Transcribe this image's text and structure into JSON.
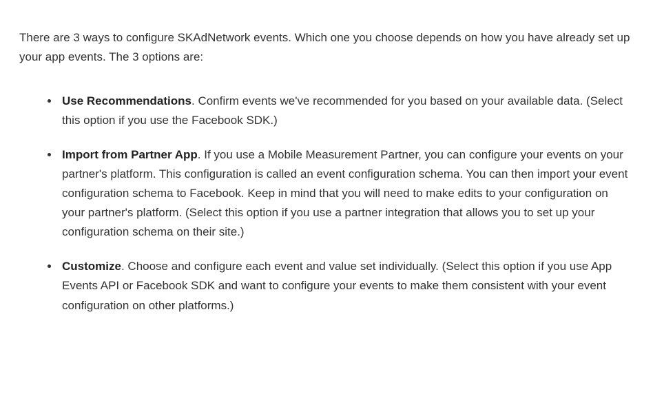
{
  "intro": "There are 3 ways to configure SKAdNetwork events. Which one you choose depends on how you have already set up your app events. The 3 options are:",
  "options": [
    {
      "title": "Use Recommendations",
      "desc": ". Confirm events we've recommended for you based on your available data. (Select this option if you use the Facebook SDK.)"
    },
    {
      "title": "Import from Partner App",
      "desc": ". If you use a Mobile Measurement Partner, you can configure your events on your partner's platform. This configuration is called an event configuration schema. You can then import your event configuration schema to Facebook. Keep in mind that you will need to make edits to your configuration on your partner's platform. (Select this option if you use a partner integration that allows you to set up your configuration schema on their site.)"
    },
    {
      "title": "Customize",
      "desc": ". Choose and configure each event and value set individually. (Select this option if you use App Events API or Facebook SDK and want to configure your events to make them consistent with your event configuration on other platforms.)"
    }
  ]
}
